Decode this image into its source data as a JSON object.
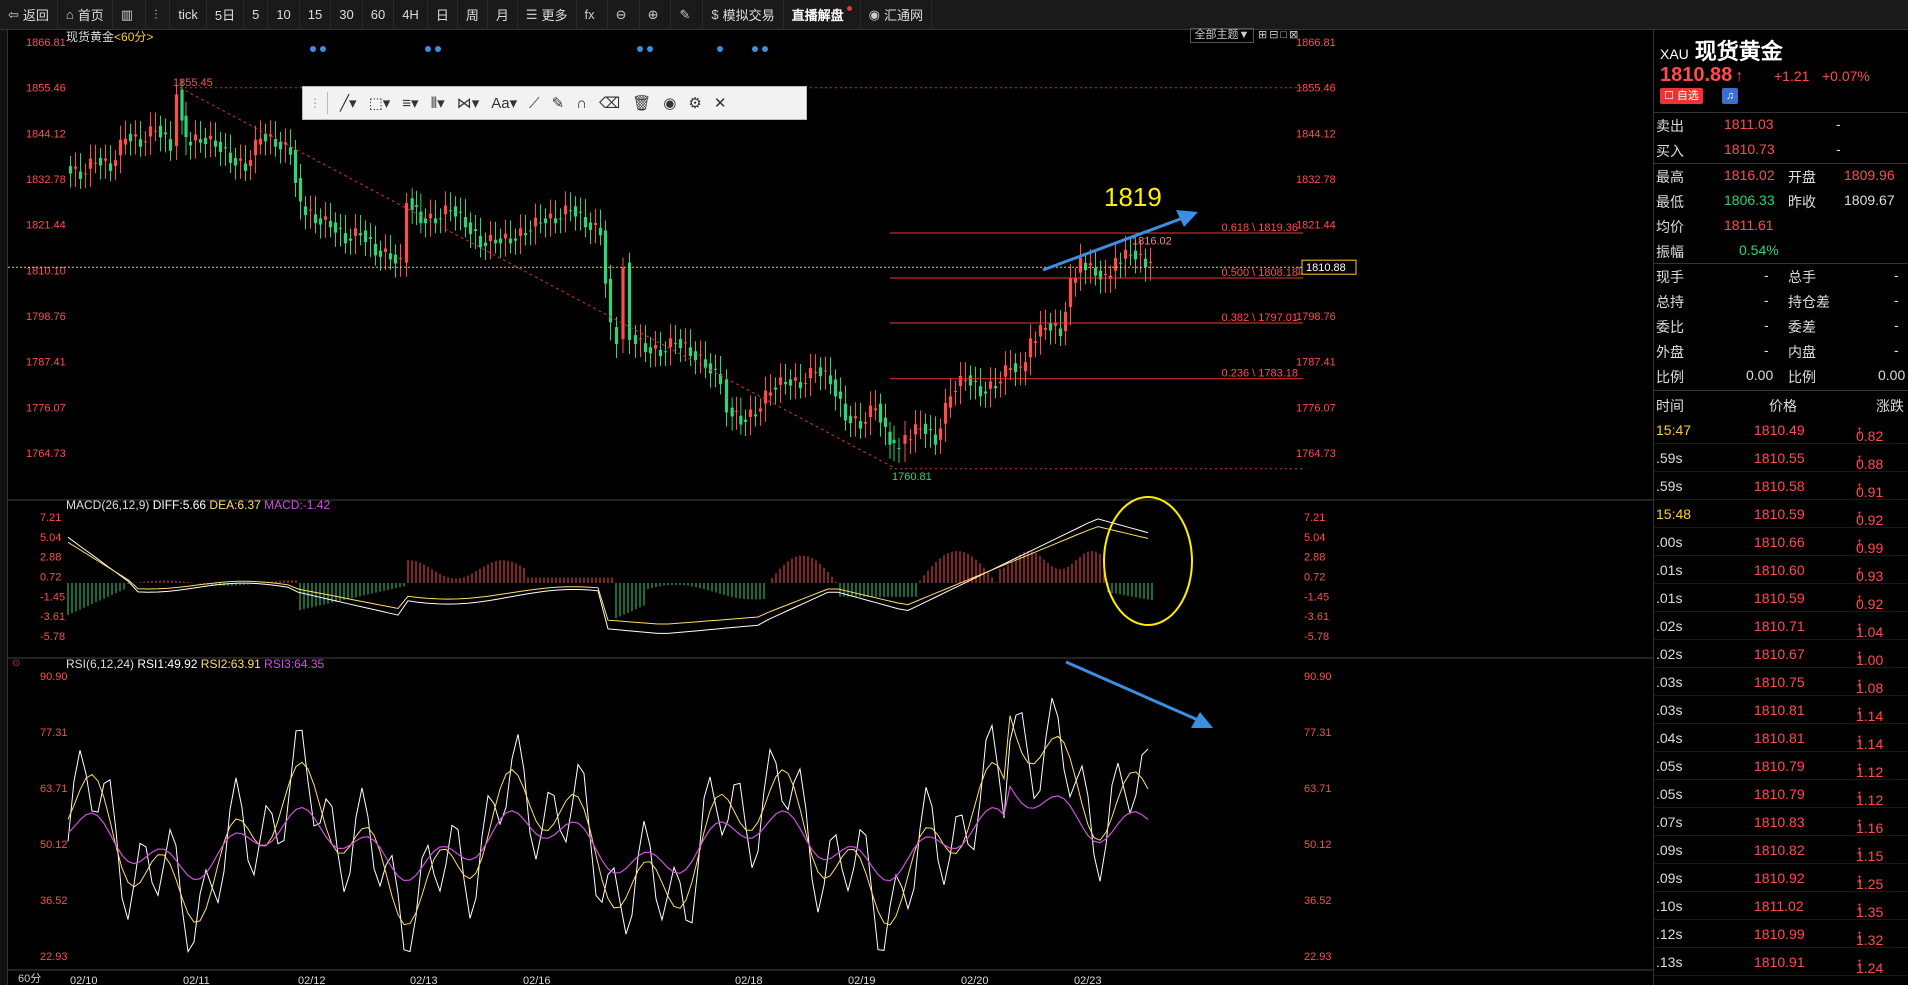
{
  "toolbar": {
    "items": [
      {
        "label": "返回",
        "icon": "back-arrow-icon",
        "glyph": "⇦"
      },
      {
        "label": "首页",
        "icon": "home-icon",
        "glyph": "⌂"
      },
      {
        "label": "",
        "icon": "bar-chart-icon",
        "glyph": "▥"
      },
      {
        "label": "",
        "icon": "candle-icon",
        "glyph": "⫶"
      },
      {
        "label": "tick",
        "icon": "",
        "glyph": ""
      },
      {
        "label": "5日",
        "icon": "",
        "glyph": ""
      },
      {
        "label": "5",
        "icon": "",
        "glyph": ""
      },
      {
        "label": "10",
        "icon": "",
        "glyph": ""
      },
      {
        "label": "15",
        "icon": "",
        "glyph": ""
      },
      {
        "label": "30",
        "icon": "",
        "glyph": ""
      },
      {
        "label": "60",
        "icon": "",
        "glyph": ""
      },
      {
        "label": "4H",
        "icon": "",
        "glyph": ""
      },
      {
        "label": "日",
        "icon": "",
        "glyph": ""
      },
      {
        "label": "周",
        "icon": "",
        "glyph": ""
      },
      {
        "label": "月",
        "icon": "",
        "glyph": ""
      },
      {
        "label": "更多",
        "icon": "list-icon",
        "glyph": "☰"
      },
      {
        "label": "",
        "icon": "fx-icon",
        "glyph": "fx"
      },
      {
        "label": "",
        "icon": "zoom-out-icon",
        "glyph": "⊖"
      },
      {
        "label": "",
        "icon": "zoom-in-icon",
        "glyph": "⊕"
      },
      {
        "label": "",
        "icon": "pen-icon",
        "glyph": "✎"
      },
      {
        "label": "模拟交易",
        "icon": "dollar-icon",
        "glyph": "$"
      },
      {
        "label": "直播解盘",
        "icon": "",
        "glyph": ""
      },
      {
        "label": "汇通网",
        "icon": "globe-icon",
        "glyph": "◉"
      }
    ]
  },
  "main": {
    "title": "现货黄金",
    "period": "<60分>",
    "theme_btn": "全部主题▼",
    "y_labels": [
      "1866.81",
      "1855.46",
      "1844.12",
      "1832.78",
      "1821.44",
      "1810.10",
      "1798.76",
      "1787.41",
      "1776.07",
      "1764.73"
    ],
    "high_label": "1855.45",
    "low_label": "1760.81",
    "peak_label": "1816.02",
    "current_label": "1810.88",
    "big_label": "1819",
    "fib": [
      {
        "label": "0.618 \\ 1819.36"
      },
      {
        "label": "0.500 \\ 1808.18"
      },
      {
        "label": "0.382 \\ 1797.01"
      },
      {
        "label": "0.236 \\ 1783.18"
      }
    ]
  },
  "macd": {
    "name": "MACD(26,12,9)",
    "diff": "DIFF:5.66",
    "dea": "DEA:6.37",
    "macd": "MACD:-1.42",
    "y_labels": [
      "7.21",
      "5.04",
      "2.88",
      "0.72",
      "-1.45",
      "-3.61",
      "-5.78"
    ]
  },
  "rsi": {
    "name": "RSI(6,12,24)",
    "rsi1": "RSI1:49.92",
    "rsi2": "RSI2:63.91",
    "rsi3": "RSI3:64.35",
    "y_labels": [
      "90.90",
      "77.31",
      "63.71",
      "50.12",
      "36.52",
      "22.93"
    ]
  },
  "x_labels": [
    "02/10",
    "02/11",
    "02/12",
    "02/13",
    "02/16",
    "02/18",
    "02/19",
    "02/20",
    "02/23"
  ],
  "status_left": "60分",
  "panel": {
    "code": "XAU",
    "name": "现货黄金",
    "price": "1810.88",
    "change": "+1.21",
    "pct": "+0.07%",
    "btn_fav": "自选",
    "sell_label": "卖出",
    "sell_val": "1811.03",
    "sell_dash": "-",
    "buy_label": "买入",
    "buy_val": "1810.73",
    "buy_dash": "-",
    "high_label": "最高",
    "high_val": "1816.02",
    "open_label": "开盘",
    "open_val": "1809.96",
    "low_label": "最低",
    "low_val": "1806.33",
    "prev_label": "昨收",
    "prev_val": "1809.67",
    "avg_label": "均价",
    "avg_val": "1811.61",
    "amp_label": "振幅",
    "amp_val": "0.54%",
    "r1a": "现手",
    "r1b": "-",
    "r1c": "总手",
    "r1d": "-",
    "r2a": "总持",
    "r2b": "-",
    "r2c": "持仓差",
    "r2d": "-",
    "r3a": "委比",
    "r3b": "-",
    "r3c": "委差",
    "r3d": "-",
    "r4a": "外盘",
    "r4b": "-",
    "r4c": "内盘",
    "r4d": "-",
    "r5a": "比例",
    "r5b": "0.00",
    "r5c": "比例",
    "r5d": "0.00",
    "col_time": "时间",
    "col_price": "价格",
    "col_chg": "涨跌",
    "ticks": [
      {
        "t": "15:47",
        "p": "1810.49",
        "c": "0.82"
      },
      {
        "t": ".59s",
        "p": "1810.55",
        "c": "0.88"
      },
      {
        "t": ".59s",
        "p": "1810.58",
        "c": "0.91"
      },
      {
        "t": "15:48",
        "p": "1810.59",
        "c": "0.92"
      },
      {
        "t": ".00s",
        "p": "1810.66",
        "c": "0.99"
      },
      {
        "t": ".01s",
        "p": "1810.60",
        "c": "0.93"
      },
      {
        "t": ".01s",
        "p": "1810.59",
        "c": "0.92"
      },
      {
        "t": ".02s",
        "p": "1810.71",
        "c": "1.04"
      },
      {
        "t": ".02s",
        "p": "1810.67",
        "c": "1.00"
      },
      {
        "t": ".03s",
        "p": "1810.75",
        "c": "1.08"
      },
      {
        "t": ".03s",
        "p": "1810.81",
        "c": "1.14"
      },
      {
        "t": ".04s",
        "p": "1810.81",
        "c": "1.14"
      },
      {
        "t": ".05s",
        "p": "1810.79",
        "c": "1.12"
      },
      {
        "t": ".05s",
        "p": "1810.79",
        "c": "1.12"
      },
      {
        "t": ".07s",
        "p": "1810.83",
        "c": "1.16"
      },
      {
        "t": ".09s",
        "p": "1810.82",
        "c": "1.15"
      },
      {
        "t": ".09s",
        "p": "1810.92",
        "c": "1.25"
      },
      {
        "t": ".10s",
        "p": "1811.02",
        "c": "1.35"
      },
      {
        "t": ".12s",
        "p": "1810.99",
        "c": "1.32"
      },
      {
        "t": ".13s",
        "p": "1810.91",
        "c": "1.24"
      }
    ]
  },
  "colors": {
    "up": "#ff4d4d",
    "down": "#2fd47a",
    "fib_line": "#e33",
    "annot_blue": "#3a8fe0",
    "annot_yellow": "#ffee00"
  }
}
